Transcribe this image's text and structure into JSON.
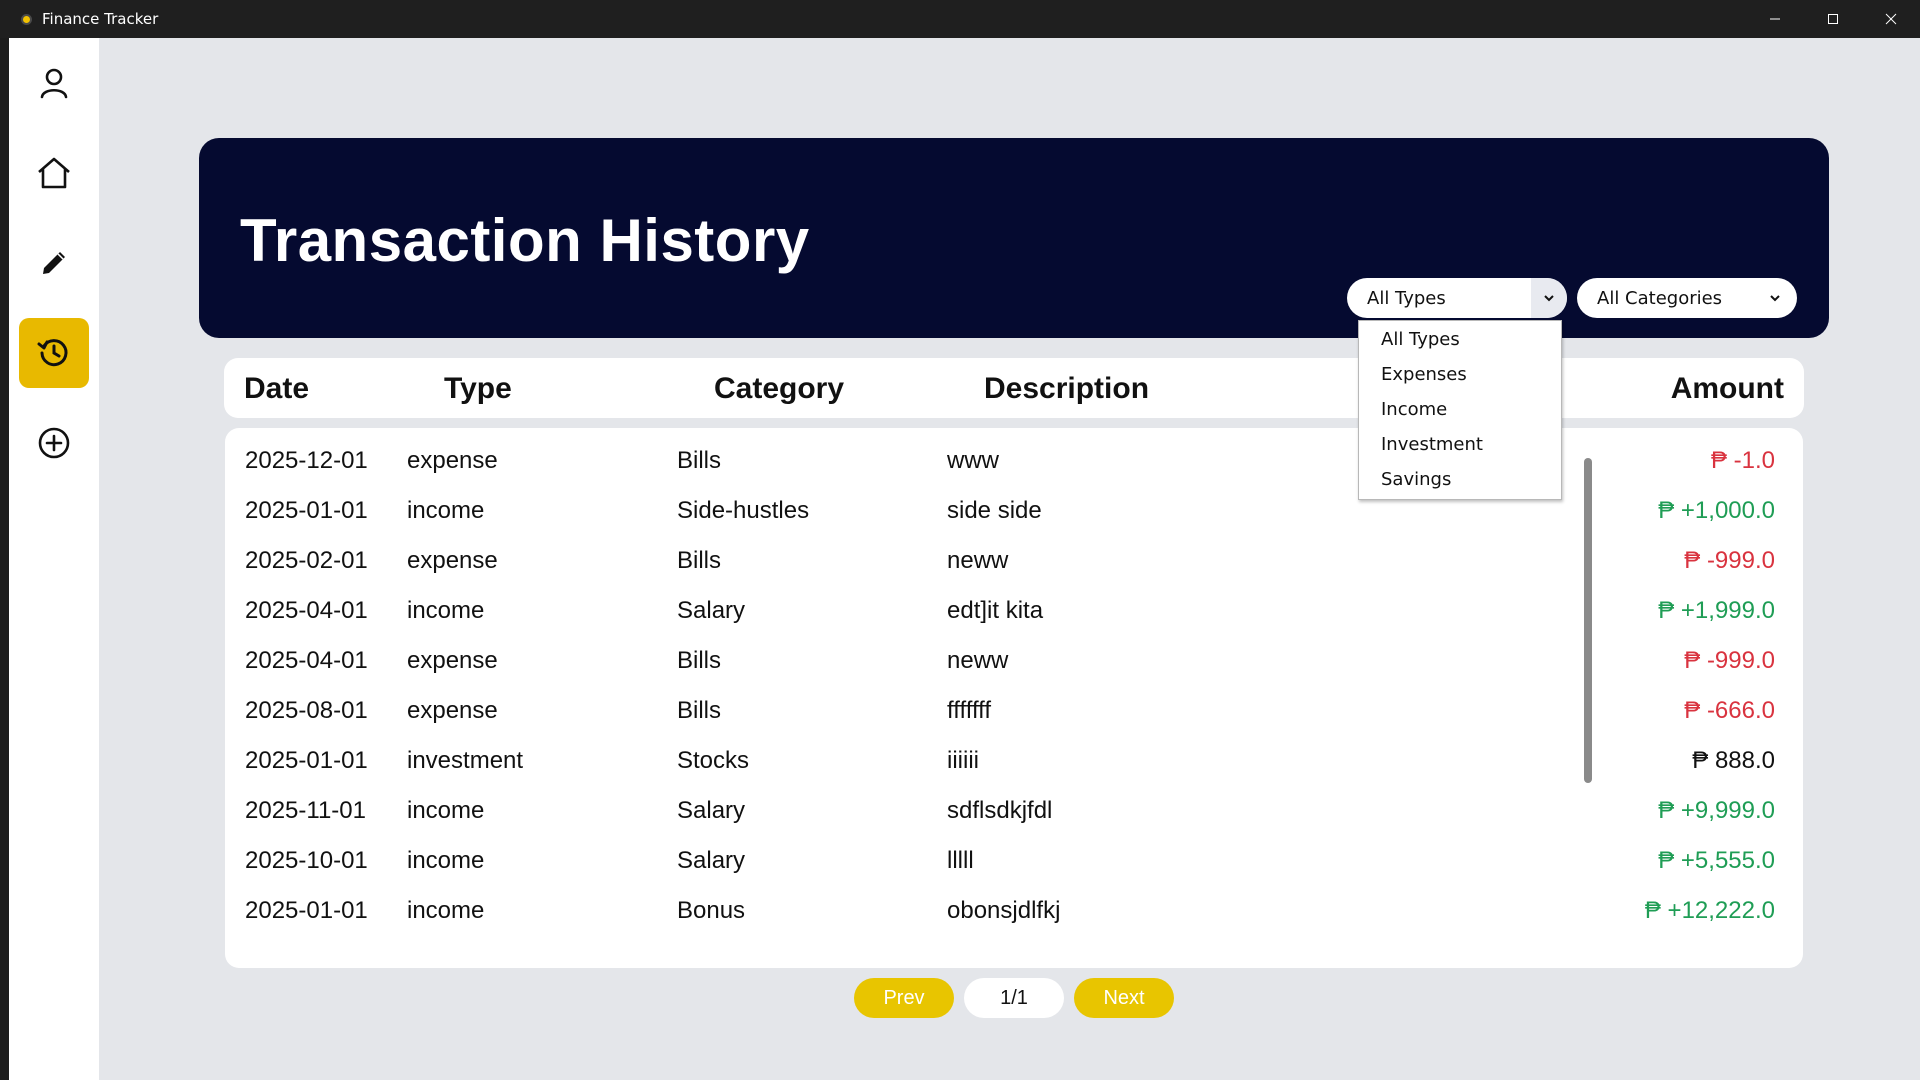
{
  "window": {
    "title": "Finance Tracker"
  },
  "sidebar": {
    "items": [
      {
        "icon": "user-icon"
      },
      {
        "icon": "home-icon"
      },
      {
        "icon": "pencil-icon"
      },
      {
        "icon": "history-icon",
        "active": true
      },
      {
        "icon": "add-circle-icon"
      }
    ]
  },
  "header": {
    "title": "Transaction History"
  },
  "filters": {
    "type": {
      "selected": "All Types",
      "options": [
        "All Types",
        "Expenses",
        "Income",
        "Investment",
        "Savings"
      ],
      "open": true
    },
    "category": {
      "selected": "All Categories"
    }
  },
  "table": {
    "columns": [
      "Date",
      "Type",
      "Category",
      "Description",
      "Amount"
    ],
    "rows": [
      {
        "date": "2025-12-01",
        "type": "expense",
        "category": "Bills",
        "description": "www",
        "amount": "₱ -1.0"
      },
      {
        "date": "2025-01-01",
        "type": "income",
        "category": "Side-hustles",
        "description": "side side",
        "amount": "₱ +1,000.0"
      },
      {
        "date": "2025-02-01",
        "type": "expense",
        "category": "Bills",
        "description": "neww",
        "amount": "₱ -999.0"
      },
      {
        "date": "2025-04-01",
        "type": "income",
        "category": "Salary",
        "description": "edt]it kita",
        "amount": "₱ +1,999.0"
      },
      {
        "date": "2025-04-01",
        "type": "expense",
        "category": "Bills",
        "description": "neww",
        "amount": "₱ -999.0"
      },
      {
        "date": "2025-08-01",
        "type": "expense",
        "category": "Bills",
        "description": "fffffff",
        "amount": "₱ -666.0"
      },
      {
        "date": "2025-01-01",
        "type": "investment",
        "category": "Stocks",
        "description": "iiiiii",
        "amount": "₱ 888.0"
      },
      {
        "date": "2025-11-01",
        "type": "income",
        "category": "Salary",
        "description": "sdflsdkjfdl",
        "amount": "₱ +9,999.0"
      },
      {
        "date": "2025-10-01",
        "type": "income",
        "category": "Salary",
        "description": "lllll",
        "amount": "₱ +5,555.0"
      },
      {
        "date": "2025-01-01",
        "type": "income",
        "category": "Bonus",
        "description": "obonsjdlfkj",
        "amount": "₱ +12,222.0"
      }
    ]
  },
  "pagination": {
    "prev": "Prev",
    "page": "1/1",
    "next": "Next"
  },
  "colors": {
    "expense": "#d9333f",
    "income": "#1f9d55",
    "investment": "#111111",
    "accent": "#e8b900",
    "header_bg": "#050a30"
  }
}
